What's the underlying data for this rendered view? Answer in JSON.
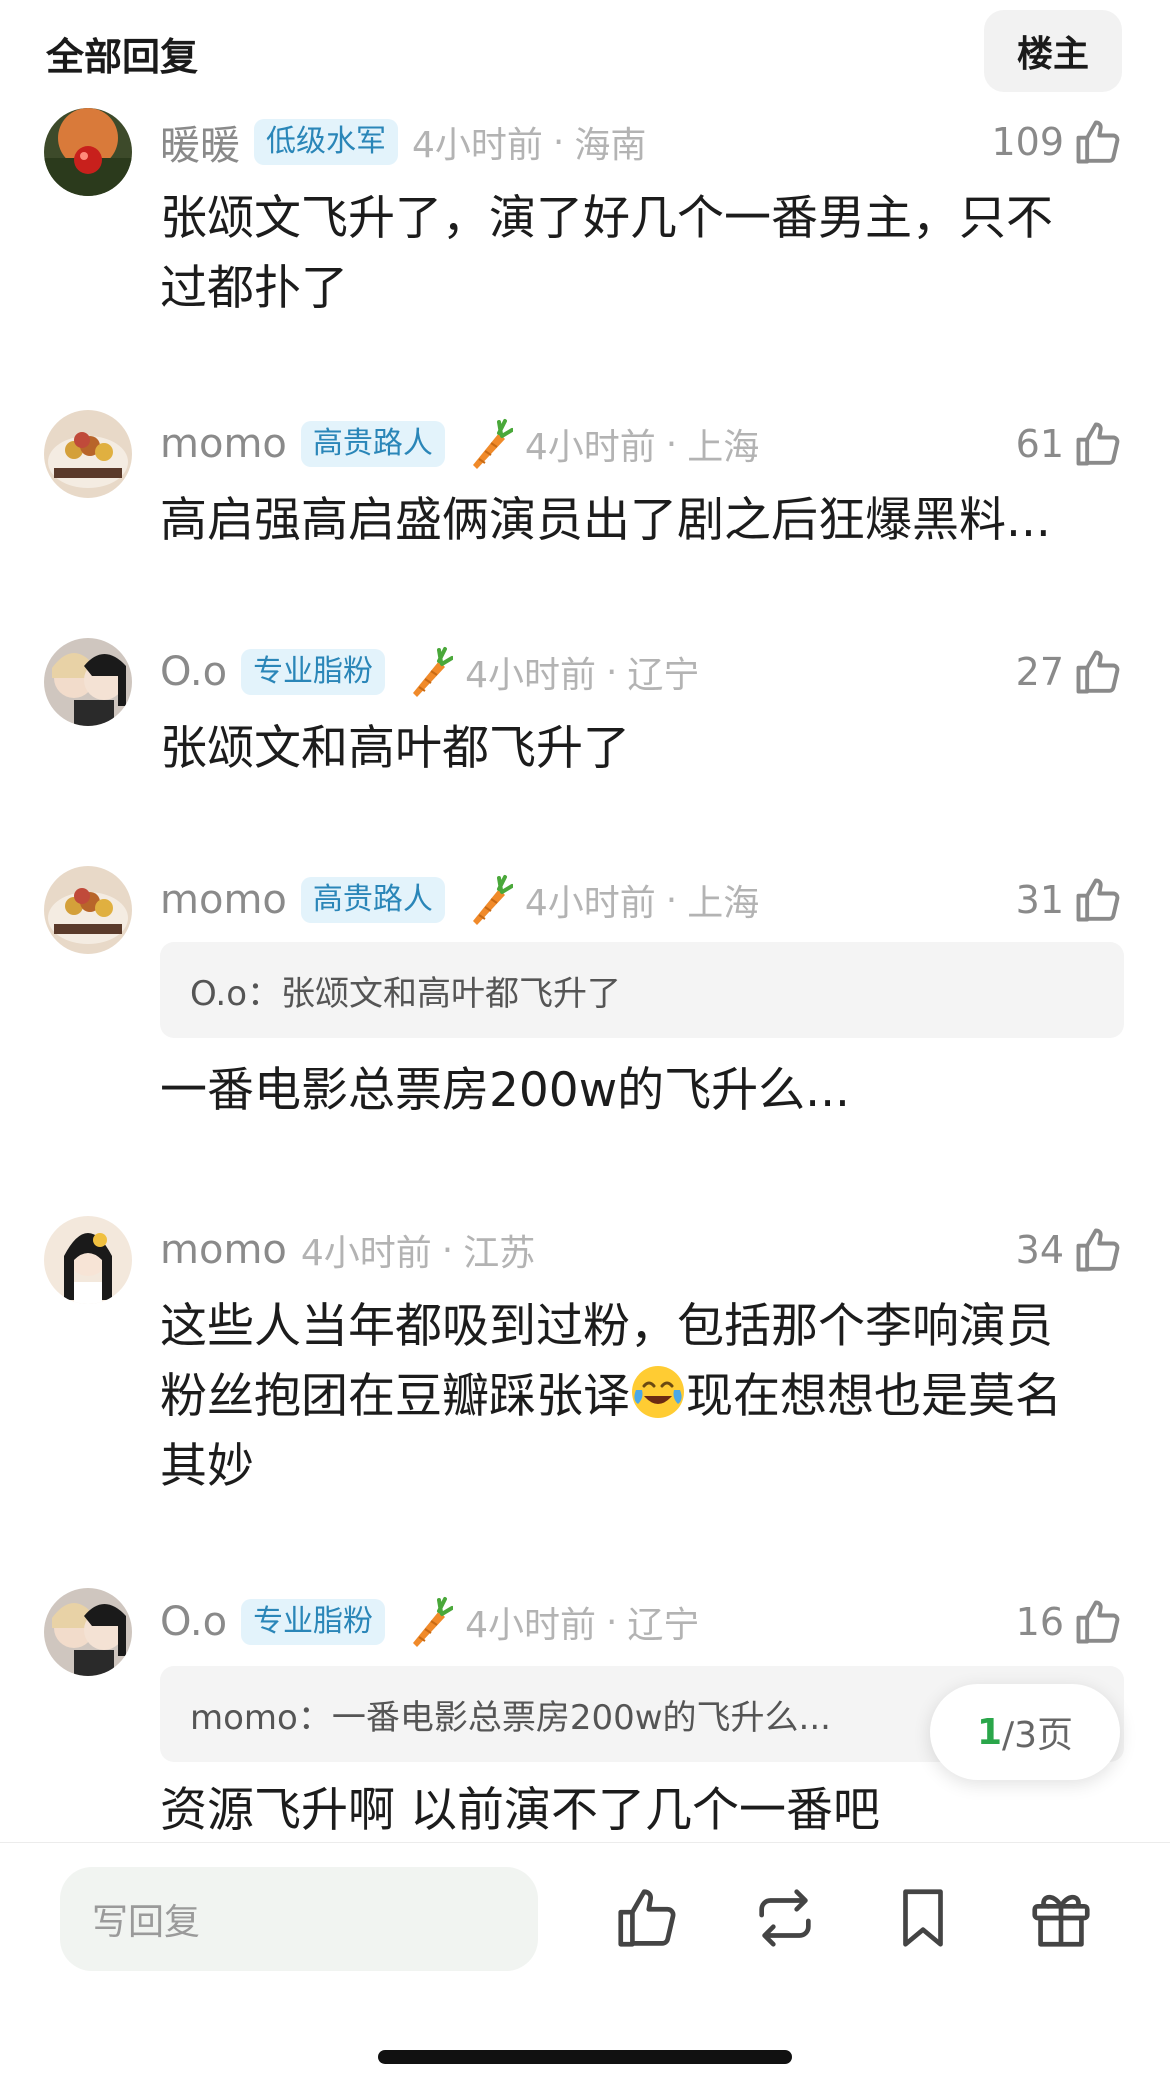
{
  "header": {
    "title": "全部回复",
    "owner_button": "楼主"
  },
  "comments": [
    {
      "username": "暖暖",
      "badge": "低级水军",
      "has_carrot": false,
      "time": "4小时前",
      "location": "海南",
      "likes": "109",
      "quote": null,
      "lines": [
        "张颂文飞升了，演了好几个一番男主，只不",
        "过都扑了"
      ]
    },
    {
      "username": "momo",
      "badge": "高贵路人",
      "has_carrot": true,
      "time": "4小时前",
      "location": "上海",
      "likes": "61",
      "quote": null,
      "lines": [
        "高启强高启盛俩演员出了剧之后狂爆黑料..."
      ]
    },
    {
      "username": "O.o",
      "badge": "专业脂粉",
      "has_carrot": true,
      "time": "4小时前",
      "location": "辽宁",
      "likes": "27",
      "quote": null,
      "lines": [
        "张颂文和高叶都飞升了"
      ]
    },
    {
      "username": "momo",
      "badge": "高贵路人",
      "has_carrot": true,
      "time": "4小时前",
      "location": "上海",
      "likes": "31",
      "quote": "O.o：张颂文和高叶都飞升了",
      "lines": [
        "一番电影总票房200w的飞升么..."
      ]
    },
    {
      "username": "momo",
      "badge": null,
      "has_carrot": false,
      "time": "4小时前",
      "location": "江苏",
      "likes": "34",
      "quote": null,
      "lines": [
        "这些人当年都吸到过粉，包括那个李响演员",
        "粉丝抱团在豆瓣踩张译",
        "现在想想也是莫名",
        "其妙"
      ]
    },
    {
      "username": "O.o",
      "badge": "专业脂粉",
      "has_carrot": true,
      "time": "4小时前",
      "location": "辽宁",
      "likes": "16",
      "quote": "momo：一番电影总票房200w的飞升么...",
      "lines": [
        "资源飞升啊 以前演不了几个一番吧"
      ]
    }
  ],
  "pagination": {
    "current": "1",
    "total": "/3页"
  },
  "bottom_bar": {
    "reply_placeholder": "写回复"
  },
  "icons": {
    "like": "thumbs-up-icon",
    "carrot": "carrot-icon",
    "emoji": "laughing-tears-emoji",
    "repost": "repost-icon",
    "bookmark": "bookmark-icon",
    "gift": "gift-icon"
  },
  "colors": {
    "badge_text": "#2a86b8",
    "badge_bg": "#e3f3fb",
    "page_current": "#2aa64a",
    "meta_gray": "#b3b3b3"
  }
}
